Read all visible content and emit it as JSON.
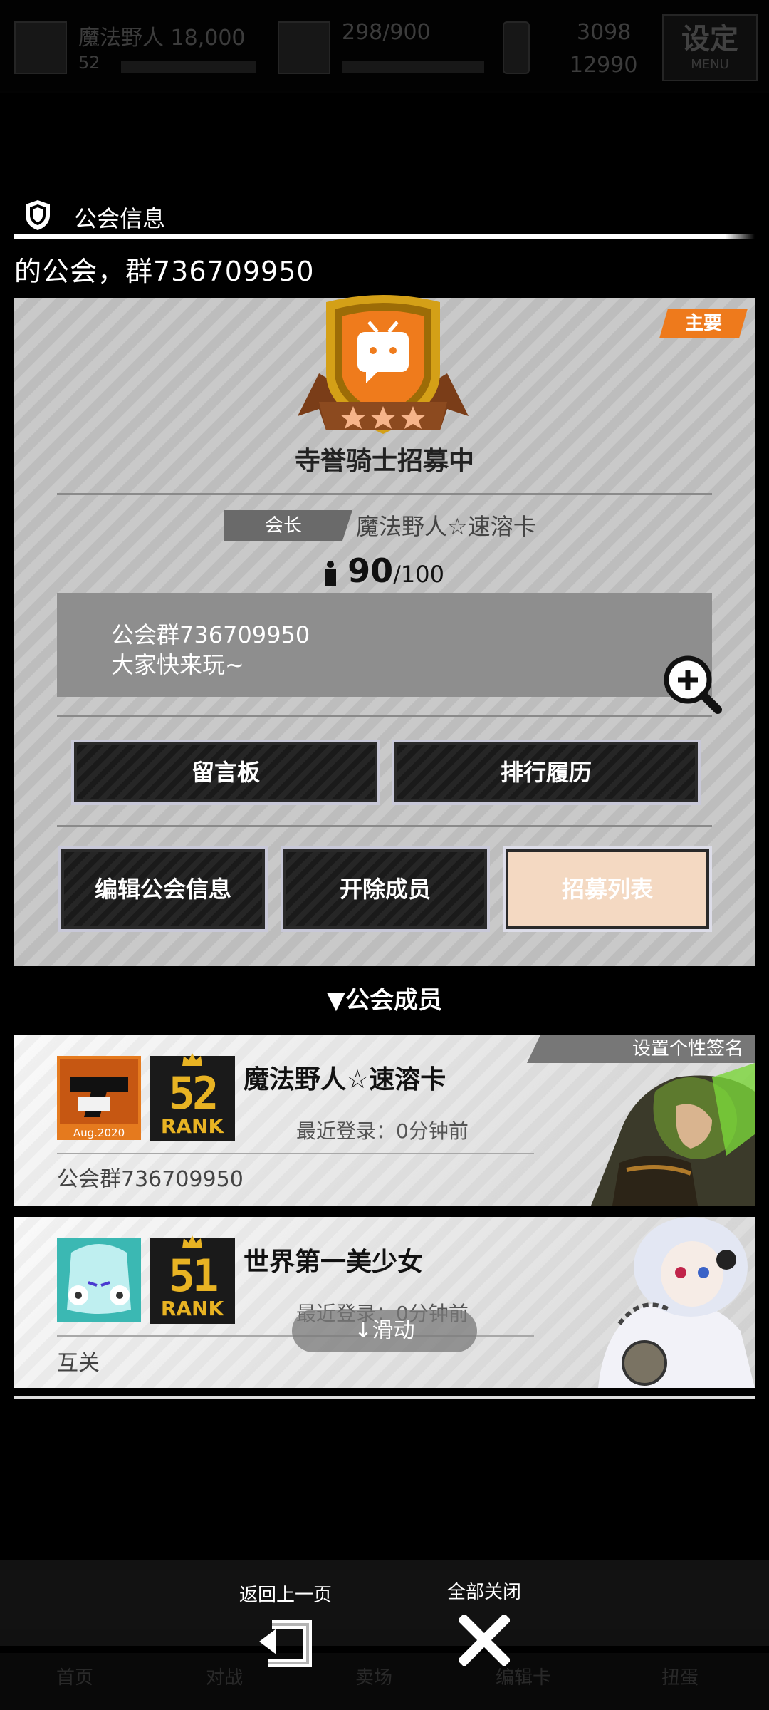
{
  "status_bar": {
    "name_level": "魔法野人  18,000",
    "level_sub": "52",
    "stamina": "298/900",
    "currency_a": "3098",
    "currency_b": "12990",
    "settings_label": "设定",
    "settings_sub": "MENU"
  },
  "section": {
    "title": "公会信息"
  },
  "marquee": "的公会，群736709950",
  "guild": {
    "main_tag": "主要",
    "name": "寺誉骑士招募中",
    "leader_label": "会长",
    "leader_name": "魔法野人☆速溶卡",
    "member_count": "90",
    "member_max": "/100",
    "notice_line1": "公会群736709950",
    "notice_line2": "大家快来玩~"
  },
  "buttons": {
    "message_board": "留言板",
    "ranking_history": "排行履历",
    "edit_info": "编辑公会信息",
    "kick_member": "开除成员",
    "recruit_list": "招募列表"
  },
  "members_title": "▼公会成员",
  "members": [
    {
      "name": "魔法野人☆速溶卡",
      "rank": "52",
      "rank_label": "RANK",
      "last_login": "最近登录：0分钟前",
      "signature": "公会群736709950",
      "avatar_text": "Aug.2020",
      "set_signature": "设置个性签名"
    },
    {
      "name": "世界第一美少女",
      "rank": "51",
      "rank_label": "RANK",
      "last_login": "最近登录：0分钟前",
      "signature": "互关"
    }
  ],
  "scroll_hint": "↓滑动",
  "bottom": {
    "back_label": "返回上一页",
    "close_all_label": "全部关闭",
    "nav": [
      "首页",
      "对战",
      "卖场",
      "编辑卡",
      "扭蛋"
    ]
  },
  "colors": {
    "accent_orange": "#ee7a1c",
    "rank_gold": "#e8b323",
    "panel_gray": "#c4c4c4"
  }
}
